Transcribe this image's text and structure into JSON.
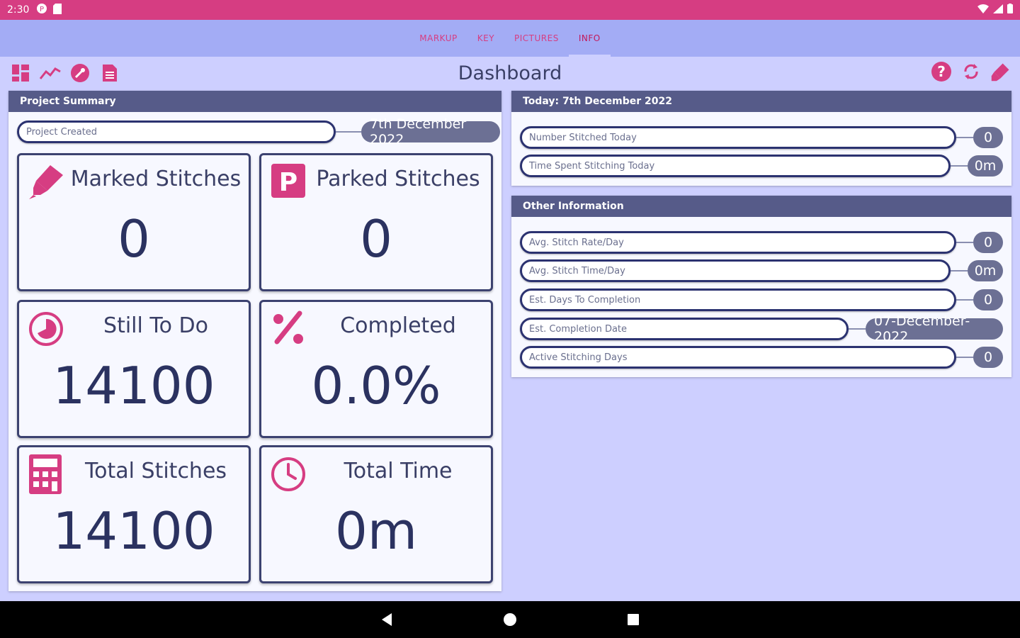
{
  "status_bar": {
    "time": "2:30"
  },
  "tabs": [
    {
      "label": "MARKUP"
    },
    {
      "label": "KEY"
    },
    {
      "label": "PICTURES"
    },
    {
      "label": "INFO"
    }
  ],
  "toolbar": {
    "title": "Dashboard",
    "left_icons": [
      "dashboard-icon",
      "trend-icon",
      "tools-icon",
      "document-icon"
    ],
    "right_icons": [
      "help-icon",
      "sync-icon",
      "highlighter-icon"
    ]
  },
  "project_summary": {
    "header": "Project Summary",
    "created": {
      "label": "Project Created",
      "value": "7th December 2022"
    },
    "cards": [
      {
        "label": "Marked Stitches",
        "value": "0",
        "icon": "marker-icon"
      },
      {
        "label": "Parked Stitches",
        "value": "0",
        "icon": "parking-icon"
      },
      {
        "label": "Still To Do",
        "value": "14100",
        "icon": "pie-icon"
      },
      {
        "label": "Completed",
        "value": "0.0%",
        "icon": "percent-icon"
      },
      {
        "label": "Total Stitches",
        "value": "14100",
        "icon": "calculator-icon"
      },
      {
        "label": "Total Time",
        "value": "0m",
        "icon": "clock-icon"
      }
    ]
  },
  "today": {
    "header": "Today: 7th December 2022",
    "rows": [
      {
        "label": "Number Stitched Today",
        "value": "0"
      },
      {
        "label": "Time Spent Stitching Today",
        "value": "0m"
      }
    ]
  },
  "other_info": {
    "header": "Other Information",
    "rows": [
      {
        "label": "Avg. Stitch Rate/Day",
        "value": "0"
      },
      {
        "label": "Avg. Stitch Time/Day",
        "value": "0m"
      },
      {
        "label": "Est. Days To Completion",
        "value": "0"
      },
      {
        "label": "Est. Completion Date",
        "value": "07-December-2022"
      },
      {
        "label": "Active Stitching Days",
        "value": "0"
      }
    ]
  },
  "colors": {
    "accent": "#d63d82",
    "header": "#565b89",
    "tab_bar": "#a3acf5",
    "background": "#cdcfff"
  }
}
